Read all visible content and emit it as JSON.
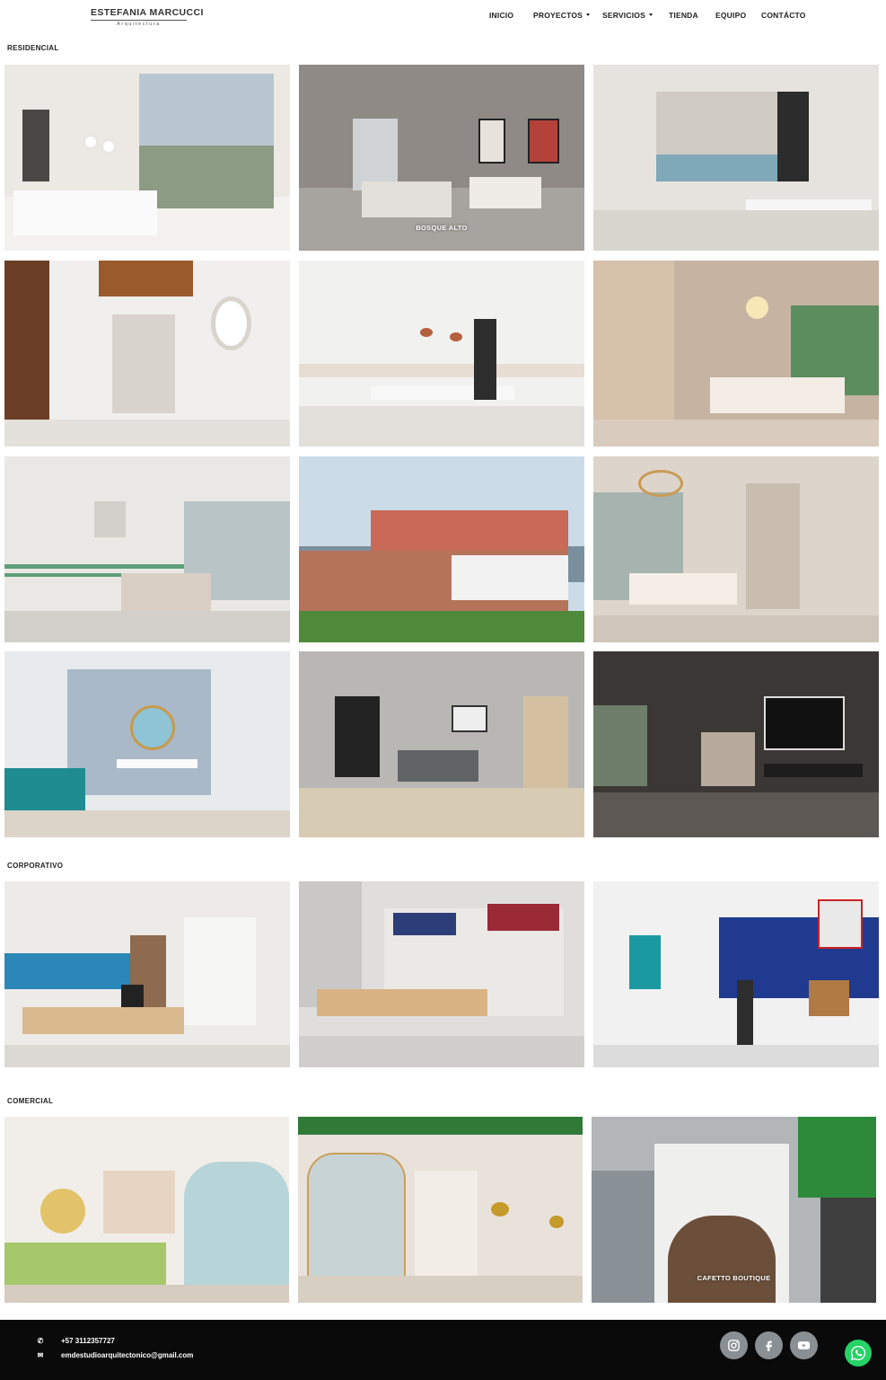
{
  "brand": {
    "name": "ESTEFANIA MARCUCCI",
    "tagline": "Arquitectura"
  },
  "nav": [
    {
      "label": "INICIO",
      "dropdown": false
    },
    {
      "label": "PROYECTOS",
      "dropdown": true
    },
    {
      "label": "SERVICIOS",
      "dropdown": true
    },
    {
      "label": "TIENDA",
      "dropdown": false
    },
    {
      "label": "EQUIPO",
      "dropdown": false
    },
    {
      "label": "CONTÁCTO",
      "dropdown": false
    }
  ],
  "sections": {
    "residencial": {
      "title": "RESIDENCIAL",
      "captions": {
        "bosque_alto": "BOSQUE ALTO"
      }
    },
    "corporativo": {
      "title": "CORPORATIVO"
    },
    "comercial": {
      "title": "COMERCIAL",
      "captions": {
        "cafetto": "CAFETTO BOUTIQUE"
      }
    }
  },
  "footer": {
    "phone": "+57 3112357727",
    "email": "emdestudioarquitectonico@gmail.com"
  },
  "social": [
    "instagram-icon",
    "facebook-icon",
    "youtube-icon"
  ],
  "whatsapp_icon": "whatsapp-icon",
  "colors": {
    "footer_bg": "#0a0a0a",
    "social_bg": "#8a8f94",
    "whatsapp": "#25d366"
  }
}
